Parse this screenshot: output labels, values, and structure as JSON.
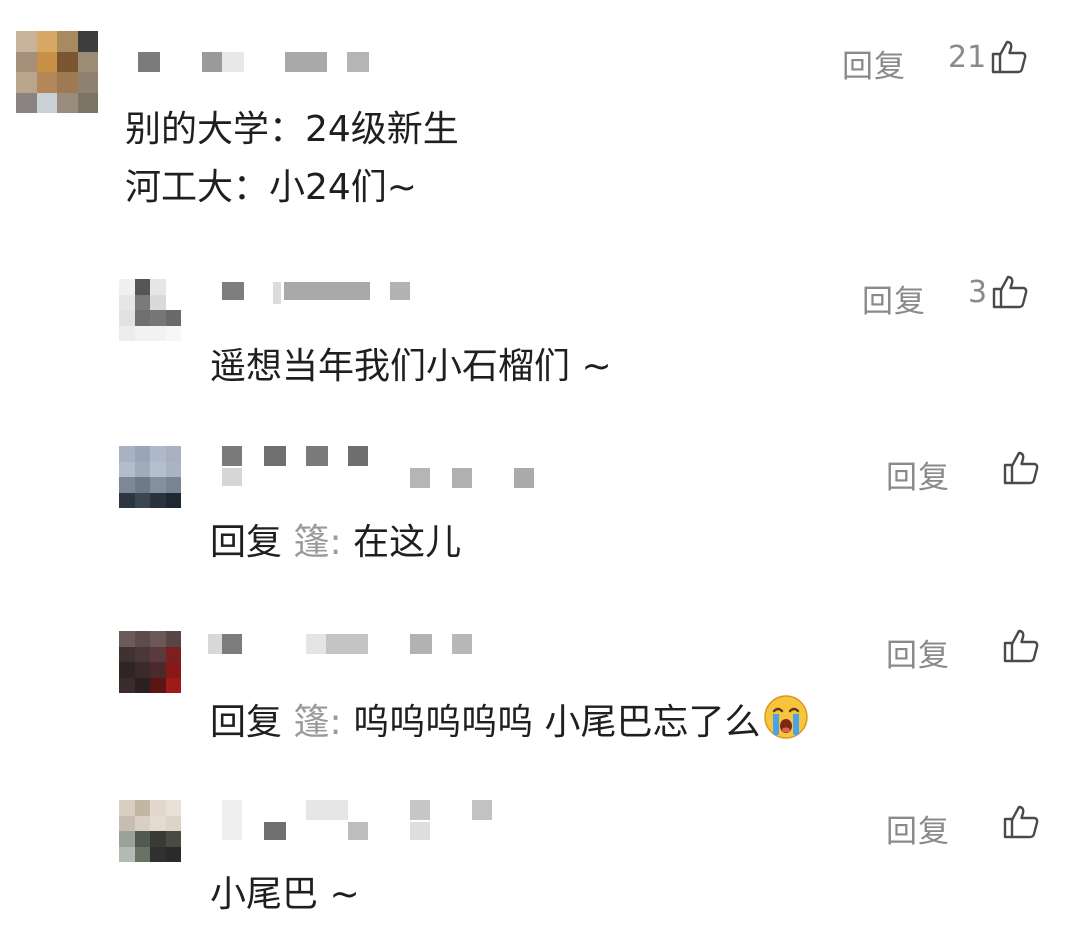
{
  "comments": [
    {
      "lines": [
        "别的大学：24级新生",
        "河工大：小24们~"
      ],
      "reply_label": "回复",
      "likes": "21"
    },
    {
      "lines": [
        "遥想当年我们小石榴们 ~"
      ],
      "reply_label": "回复",
      "likes": "3"
    },
    {
      "reply_prefix": "回复",
      "reply_target": "篷:",
      "text": "在这儿",
      "reply_label": "回复",
      "likes": ""
    },
    {
      "reply_prefix": "回复",
      "reply_target": "篷:",
      "text": "呜呜呜呜呜 小尾巴忘了么",
      "emoji": "crying-face-icon",
      "reply_label": "回复",
      "likes": ""
    },
    {
      "lines": [
        "小尾巴 ~"
      ],
      "reply_label": "回复",
      "likes": ""
    }
  ],
  "colors": {
    "meta_gray": "#8a8a8a",
    "text": "#1f1f1f",
    "reply_target": "#9a9a9a"
  }
}
